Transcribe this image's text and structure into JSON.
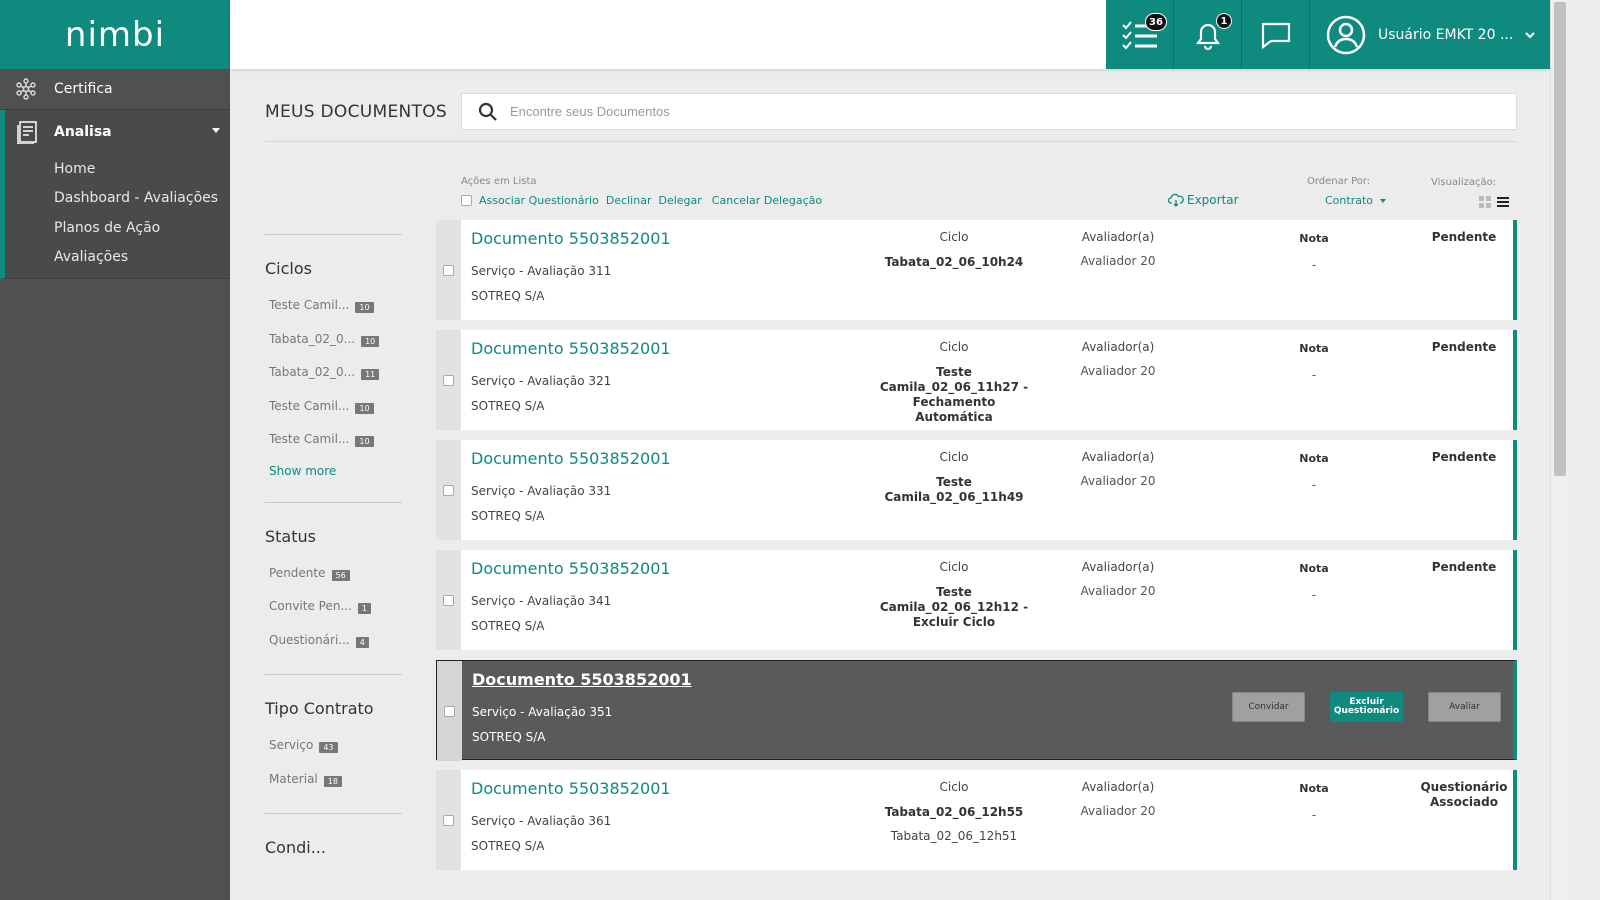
{
  "brand": {
    "logo_text": "nimbi",
    "accent": "#0e8a7f"
  },
  "sidebar": {
    "certifica": "Certifica",
    "analisa": "Analisa",
    "sub_items": [
      "Home",
      "Dashboard - Avaliações",
      "Planos de Ação",
      "Avaliações"
    ]
  },
  "topbar": {
    "tasks_badge": "36",
    "notifications_badge": "1",
    "user_name": "Usuário EMKT 20 ..."
  },
  "page": {
    "title": "MEUS DOCUMENTOS",
    "search_placeholder": "Encontre seus Documentos"
  },
  "filters": {
    "ciclos": {
      "title": "Ciclos",
      "items": [
        {
          "label": "Teste Camil...",
          "count": "10"
        },
        {
          "label": "Tabata_02_0...",
          "count": "10"
        },
        {
          "label": "Tabata_02_0...",
          "count": "11"
        },
        {
          "label": "Teste Camil...",
          "count": "10"
        },
        {
          "label": "Teste Camil...",
          "count": "10"
        }
      ],
      "show_more": "Show more"
    },
    "status": {
      "title": "Status",
      "items": [
        {
          "label": "Pendente",
          "count": "56"
        },
        {
          "label": "Convite Pen...",
          "count": "1"
        },
        {
          "label": "Questionári...",
          "count": "4"
        }
      ]
    },
    "tipo": {
      "title": "Tipo Contrato",
      "items": [
        {
          "label": "Serviço",
          "count": "43"
        },
        {
          "label": "Material",
          "count": "18"
        }
      ]
    },
    "next_title": "Condi..."
  },
  "toolbar": {
    "caption": "Ações em Lista",
    "associar": "Associar Questionário",
    "declinar": "Declinar",
    "delegar": "Delegar",
    "cancelar": "Cancelar Delegação",
    "exportar": "Exportar",
    "order_caption": "Ordenar Por:",
    "order_value": "Contrato",
    "view_caption": "Visualização:"
  },
  "labels": {
    "ciclo": "Ciclo",
    "avaliador": "Avaliador(a)",
    "nota": "Nota"
  },
  "cards": [
    {
      "title": "Documento 5503852001",
      "service": "Serviço - Avaliação 311",
      "company": "SOTREQ S/A",
      "ciclo": "Tabata_02_06_10h24",
      "ciclo2": "",
      "avaliador": "Avaliador 20",
      "nota": "-",
      "status": "Pendente"
    },
    {
      "title": "Documento 5503852001",
      "service": "Serviço - Avaliação 321",
      "company": "SOTREQ S/A",
      "ciclo": "Teste Camila_02_06_11h27 - Fechamento Automática",
      "ciclo2": "",
      "avaliador": "Avaliador 20",
      "nota": "-",
      "status": "Pendente"
    },
    {
      "title": "Documento 5503852001",
      "service": "Serviço - Avaliação 331",
      "company": "SOTREQ S/A",
      "ciclo": "Teste Camila_02_06_11h49",
      "ciclo2": "",
      "avaliador": "Avaliador 20",
      "nota": "-",
      "status": "Pendente"
    },
    {
      "title": "Documento 5503852001",
      "service": "Serviço - Avaliação 341",
      "company": "SOTREQ S/A",
      "ciclo": "Teste Camila_02_06_12h12 - Excluir Ciclo",
      "ciclo2": "",
      "avaliador": "Avaliador 20",
      "nota": "-",
      "status": "Pendente"
    },
    {
      "title": "Documento 5503852001",
      "service": "Serviço - Avaliação 351",
      "company": "SOTREQ S/A",
      "buttons": {
        "convidar": "Convidar",
        "excluir": "Excluir Questionário",
        "avaliar": "Avaliar"
      }
    },
    {
      "title": "Documento 5503852001",
      "service": "Serviço - Avaliação 361",
      "company": "SOTREQ S/A",
      "ciclo": "Tabata_02_06_12h55",
      "ciclo2": "Tabata_02_06_12h51",
      "avaliador": "Avaliador 20",
      "nota": "-",
      "status": "Questionário Associado"
    }
  ]
}
